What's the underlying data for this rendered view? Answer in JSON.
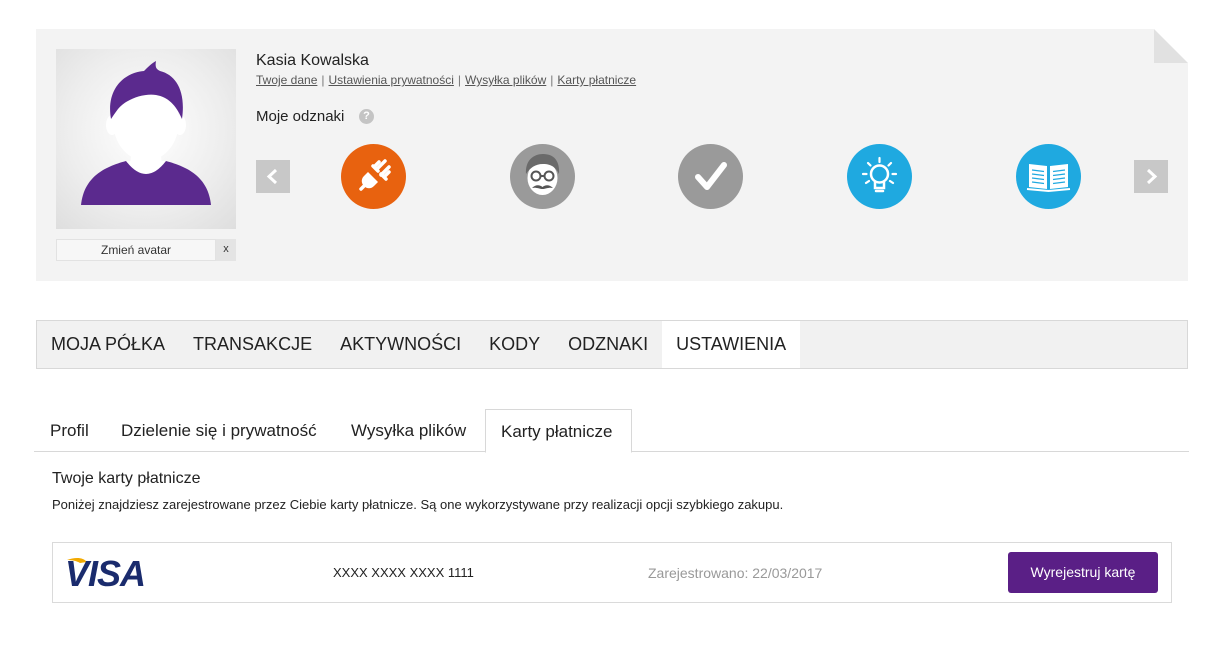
{
  "profile": {
    "name": "Kasia Kowalska",
    "links": [
      "Twoje dane",
      "Ustawienia prywatności",
      "Wysyłka plików",
      "Karty płatnicze"
    ],
    "change_avatar": "Zmień avatar",
    "remove_avatar": "x",
    "badges_title": "Moje odznaki",
    "help": "?",
    "badges": [
      {
        "icon": "plug-icon",
        "color": "#e8620f"
      },
      {
        "icon": "hipster-face-icon",
        "color": "#9a9a9a"
      },
      {
        "icon": "checkmark-icon",
        "color": "#9a9a9a"
      },
      {
        "icon": "lightbulb-icon",
        "color": "#1fa9e0"
      },
      {
        "icon": "open-book-icon",
        "color": "#1fa9e0"
      }
    ]
  },
  "main_nav": {
    "items": [
      "MOJA PÓŁKA",
      "TRANSAKCJE",
      "AKTYWNOŚCI",
      "KODY",
      "ODZNAKI",
      "USTAWIENIA"
    ],
    "active": "USTAWIENIA"
  },
  "sub_tabs": {
    "items": [
      "Profil",
      "Dzielenie się i prywatność",
      "Wysyłka plików",
      "Karty płatnicze"
    ],
    "active": "Karty płatnicze"
  },
  "cards_section": {
    "title": "Twoje karty płatnicze",
    "description": "Poniżej znajdziesz zarejestrowane przez Ciebie karty płatnicze. Są one wykorzystywane przy realizacji opcji szybkiego zakupu.",
    "cards": [
      {
        "brand": "VISA",
        "number": "XXXX XXXX XXXX 1111",
        "registered": "Zarejestrowano: 22/03/2017",
        "action": "Wyrejestruj kartę"
      }
    ]
  },
  "colors": {
    "accent": "#5a1f86",
    "avatar_purple": "#5b2a8e",
    "visa_blue": "#1a2b6d",
    "visa_gold": "#f2a900"
  }
}
